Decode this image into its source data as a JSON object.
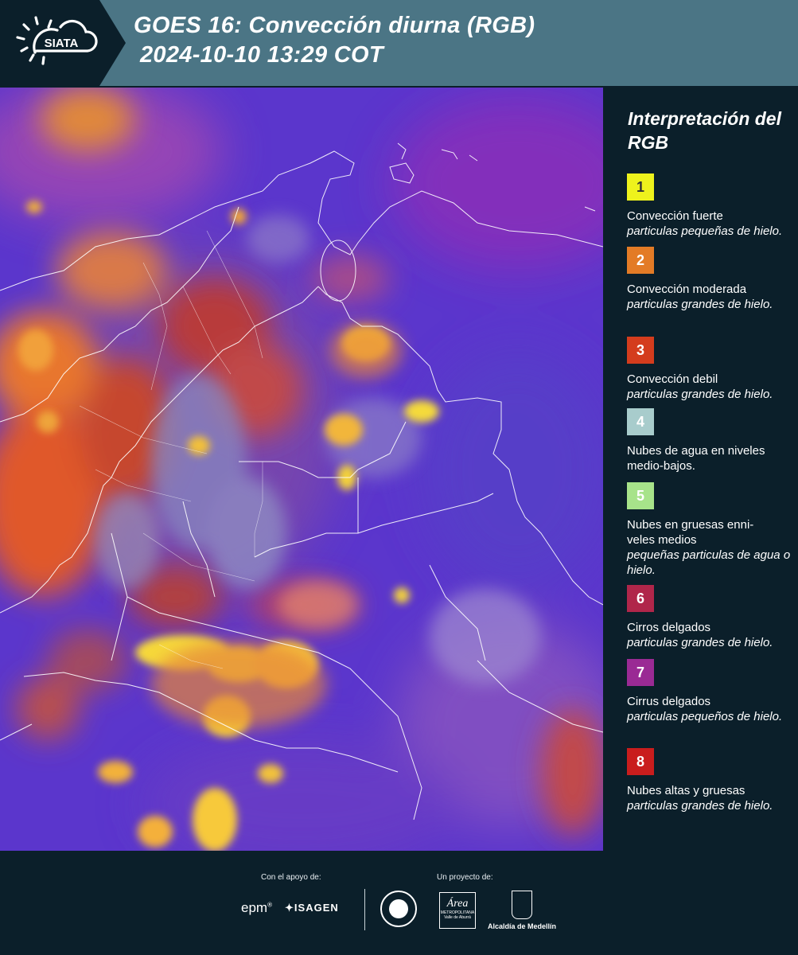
{
  "header": {
    "logo_text": "SIATA",
    "title_line1": "GOES 16: Convección diurna (RGB)",
    "title_line2": "2024-10-10 13:29 COT"
  },
  "legend": {
    "title": "Interpretación del RGB",
    "items": [
      {
        "number": "1",
        "color": "#eef21c",
        "title": "",
        "desc": "Convección fuerte particulas pequeñas de hielo."
      },
      {
        "number": "2",
        "color": "#e37b26",
        "title": "",
        "desc": "Convección moderada particulas grandes de hielo."
      },
      {
        "number": "3",
        "color": "#d43c1d",
        "title": "",
        "desc": "Convección debil particulas grandes de hielo."
      },
      {
        "number": "4",
        "color": "#a8cccc",
        "title": "Nubes de agua en niveles medio-bajos.",
        "desc": ""
      },
      {
        "number": "5",
        "color": "#a7e38a",
        "title": "",
        "desc": "Nubes en gruesas enni-veles medios pequeñas particulas de agua o hielo."
      },
      {
        "number": "6",
        "color": "#b0264a",
        "title": "",
        "desc": "Cirros delgados particulas grandes de hielo."
      },
      {
        "number": "7",
        "color": "#9a2a94",
        "title": "",
        "desc": "Cirrus delgados particulas pequeños de hielo."
      },
      {
        "number": "8",
        "color": "#c91d1d",
        "title": "",
        "desc": "Nubes altas y gruesas particulas grandes de hielo."
      }
    ]
  },
  "footer": {
    "support_label": "Con el apoyo de:",
    "project_label": "Un proyecto de:",
    "sponsor1": "epm",
    "sponsor2": "ISAGEN",
    "partner_area": "Área",
    "partner_area_sub": "METROPOLITANA",
    "partner_area_sub2": "Valle de Aburrá",
    "partner_medellin": "Alcaldía de Medellín"
  }
}
